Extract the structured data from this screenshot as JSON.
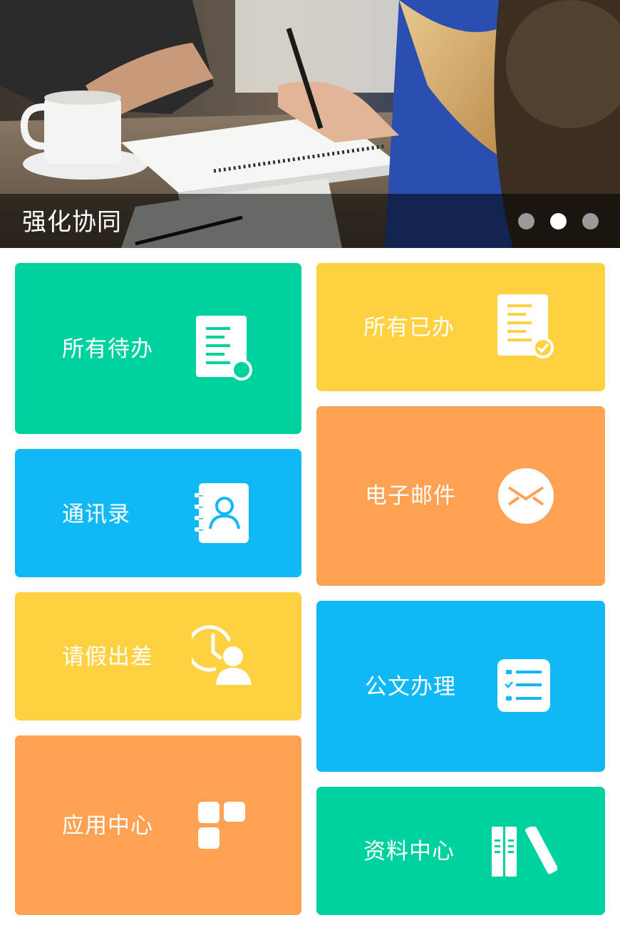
{
  "banner": {
    "title": "强化协同",
    "slide_count": 3,
    "active_slide": 2
  },
  "tiles": {
    "todo": {
      "label": "所有待办",
      "icon": "document-list-icon",
      "color": "#00d29f"
    },
    "done": {
      "label": "所有已办",
      "icon": "document-check-icon",
      "color": "#fdd13f"
    },
    "contacts": {
      "label": "通讯录",
      "icon": "address-book-icon",
      "color": "#11b8f6"
    },
    "mail": {
      "label": "电子邮件",
      "icon": "envelope-icon",
      "color": "#fda253"
    },
    "leave": {
      "label": "请假出差",
      "icon": "clock-person-icon",
      "color": "#fdd13f"
    },
    "docs": {
      "label": "公文办理",
      "icon": "checklist-icon",
      "color": "#11b8f6"
    },
    "apps": {
      "label": "应用中心",
      "icon": "app-grid-icon",
      "color": "#fda253"
    },
    "files": {
      "label": "资料中心",
      "icon": "books-icon",
      "color": "#00d29f"
    }
  }
}
